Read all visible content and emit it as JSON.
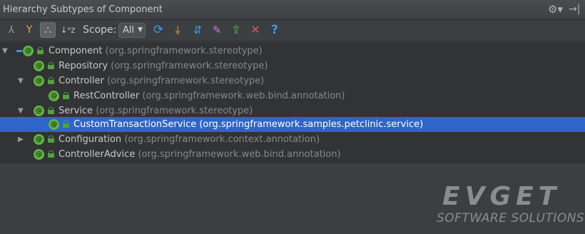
{
  "window": {
    "title": "Hierarchy Subtypes of Component",
    "gear_icon": "gear-icon",
    "hide_icon": "hide-panel-icon"
  },
  "toolbar": {
    "buttons": [
      {
        "icon": "supertypes-hierarchy-icon",
        "glyph": "⅄"
      },
      {
        "icon": "subtypes-hierarchy-icon",
        "glyph": "⑂"
      },
      {
        "icon": "class-hierarchy-icon",
        "glyph": "⛬"
      },
      {
        "icon": "sort-alphabetically-icon",
        "glyph": "↓ᵃz"
      }
    ],
    "scope_label": "Scope:",
    "scope_value": "All",
    "actions": [
      {
        "icon": "refresh-icon",
        "glyph": "⟳",
        "color": "#3d9be9"
      },
      {
        "icon": "autoscroll-to-source-icon",
        "glyph": "⤓",
        "color": "#e8a33c"
      },
      {
        "icon": "autoscroll-from-source-icon",
        "glyph": "⇵",
        "color": "#3d9be9"
      },
      {
        "icon": "pin-icon",
        "glyph": "✎",
        "color": "#c77dd8"
      },
      {
        "icon": "export-icon",
        "glyph": "⇪",
        "color": "#62b543"
      },
      {
        "icon": "close-icon",
        "glyph": "✕",
        "color": "#e05555"
      },
      {
        "icon": "help-icon",
        "glyph": "?",
        "color": "#3d9be9"
      }
    ]
  },
  "tree": {
    "rows": [
      {
        "name": "Component",
        "package": "(org.springframework.stereotype)",
        "expanded": true,
        "has_children": true
      },
      {
        "name": "Repository",
        "package": "(org.springframework.stereotype)",
        "has_children": false
      },
      {
        "name": "Controller",
        "package": "(org.springframework.stereotype)",
        "expanded": true,
        "has_children": true
      },
      {
        "name": "RestController",
        "package": "(org.springframework.web.bind.annotation)",
        "has_children": false
      },
      {
        "name": "Service",
        "package": "(org.springframework.stereotype)",
        "expanded": true,
        "has_children": true
      },
      {
        "name": "CustomTransactionService",
        "package": "(org.springframework.samples.petclinic.service)",
        "selected": true,
        "has_children": false
      },
      {
        "name": "Configuration",
        "package": "(org.springframework.context.annotation)",
        "expanded": false,
        "has_children": true
      },
      {
        "name": "ControllerAdvice",
        "package": "(org.springframework.web.bind.annotation)",
        "has_children": false
      }
    ],
    "badge_symbol": "@"
  },
  "watermark": {
    "line1": "EVGET",
    "line2": "SOFTWARE SOLUTIONS"
  }
}
